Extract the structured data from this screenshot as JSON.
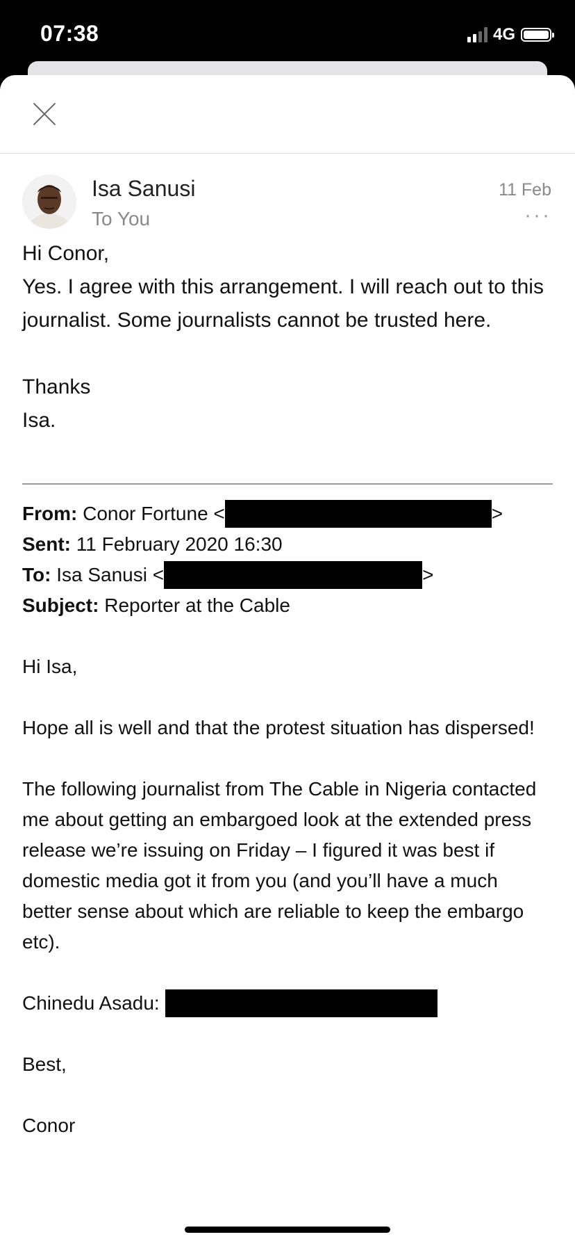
{
  "status_bar": {
    "time": "07:38",
    "network": "4G",
    "signal_bars_filled": 2,
    "signal_bars_total": 4,
    "battery_level": 1.0
  },
  "header": {
    "close_icon": "close-icon"
  },
  "message": {
    "sender": "Isa Sanusi",
    "recipient_line": "To You",
    "date": "11 Feb",
    "more_icon": "···",
    "body": {
      "greeting": "Hi Conor,",
      "paragraph": "Yes. I agree with this arrangement. I will reach out to this journalist. Some journalists cannot be trusted here.",
      "signoff": "Thanks",
      "signature": "Isa."
    }
  },
  "quoted": {
    "from_label": "From:",
    "from_value": "Conor Fortune <",
    "sent_label": "Sent:",
    "sent_value": "11 February 2020 16:30",
    "to_label": "To:",
    "to_value": "Isa Sanusi <",
    "subject_label": "Subject:",
    "subject_value": "Reporter at the Cable",
    "greeting": "Hi Isa,",
    "paragraph1": "Hope all is well and that the protest situation has dispersed!",
    "paragraph2": "The following journalist from The Cable in Nigeria contacted me about getting an embargoed look at the extended press release we’re issuing on Friday – I figured it was best if domestic media got it from you (and you’ll have a much better sense about which are reliable to keep the embargo etc).",
    "contact_label": "Chinedu Asadu:",
    "signoff": "Best,",
    "signature": "Conor",
    "close_bracket": ">"
  }
}
